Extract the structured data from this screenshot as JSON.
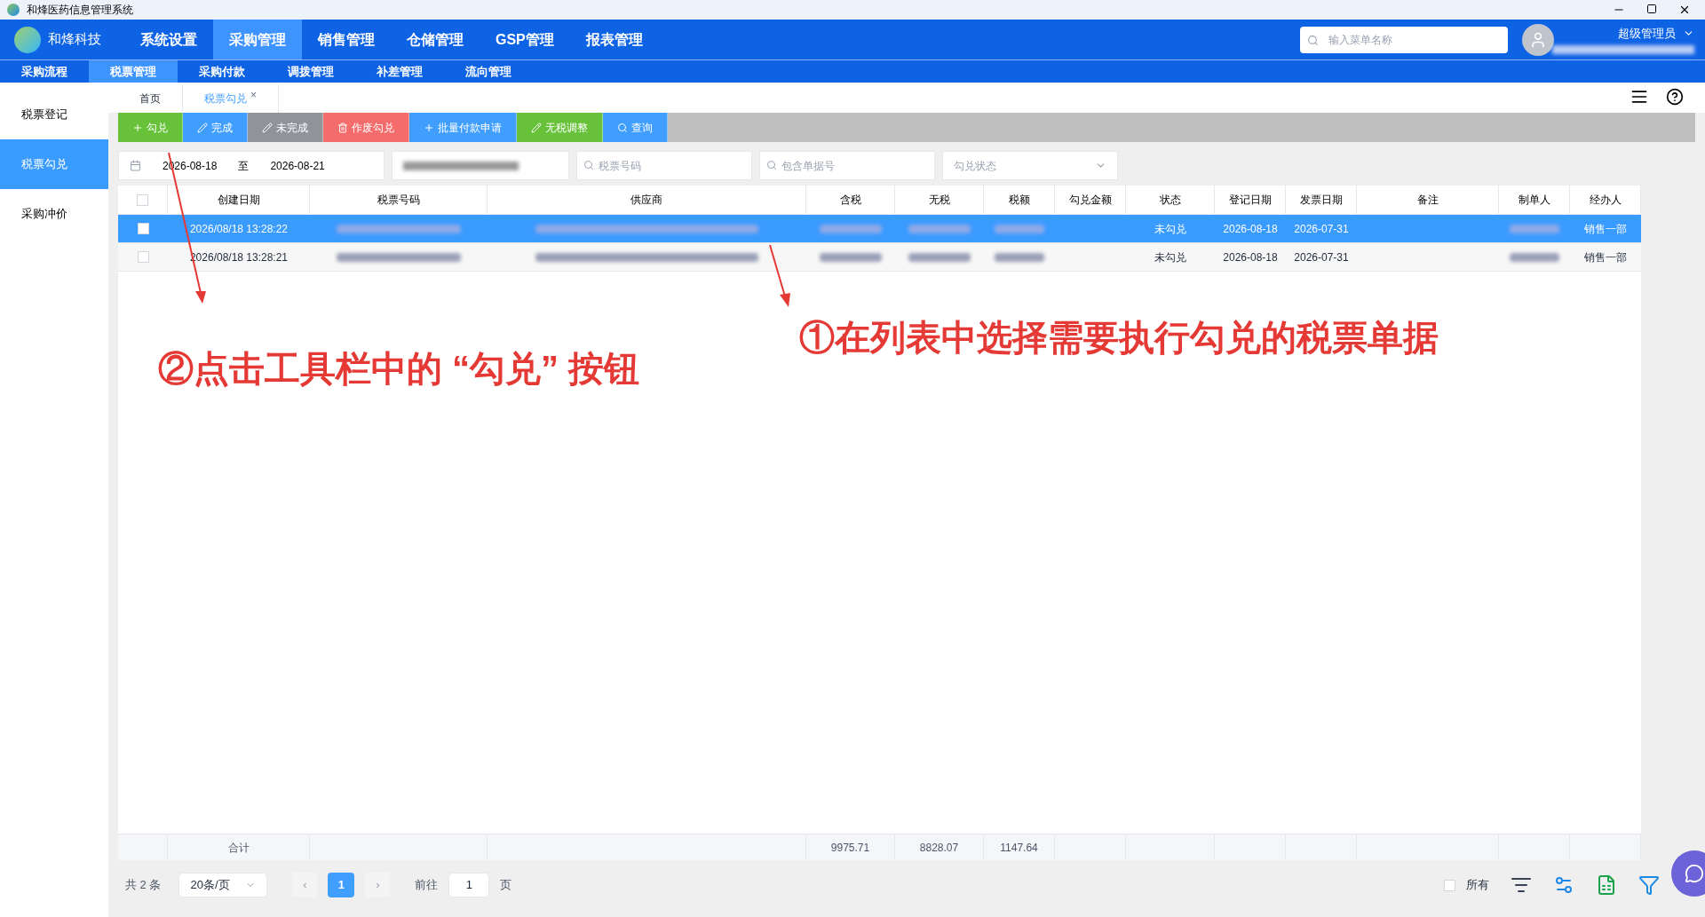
{
  "window": {
    "title": "和烽医药信息管理系统"
  },
  "brand": "和烽科技",
  "main_nav": [
    {
      "label": "系统设置",
      "selected": false
    },
    {
      "label": "采购管理",
      "selected": true
    },
    {
      "label": "销售管理",
      "selected": false
    },
    {
      "label": "仓储管理",
      "selected": false
    },
    {
      "label": "GSP管理",
      "selected": false
    },
    {
      "label": "报表管理",
      "selected": false
    }
  ],
  "menu_search": {
    "placeholder": "输入菜单名称"
  },
  "user": {
    "name": "超级管理员"
  },
  "sub_nav": [
    {
      "label": "采购流程",
      "selected": false
    },
    {
      "label": "税票管理",
      "selected": true
    },
    {
      "label": "采购付款",
      "selected": false
    },
    {
      "label": "调拨管理",
      "selected": false
    },
    {
      "label": "补差管理",
      "selected": false
    },
    {
      "label": "流向管理",
      "selected": false
    }
  ],
  "sidebar": {
    "items": [
      {
        "label": "税票登记",
        "selected": false
      },
      {
        "label": "税票勾兑",
        "selected": true
      },
      {
        "label": "采购冲价",
        "selected": false
      }
    ]
  },
  "page_tabs": [
    {
      "label": "首页",
      "selected": false,
      "closable": false
    },
    {
      "label": "税票勾兑",
      "selected": true,
      "closable": true
    }
  ],
  "close_glyph": "×",
  "toolbar": [
    {
      "label": "勾兑",
      "kind": "plus",
      "color": "#67c23a"
    },
    {
      "label": "完成",
      "kind": "edit",
      "color": "#409eff"
    },
    {
      "label": "未完成",
      "kind": "edit",
      "color": "#909399"
    },
    {
      "label": "作废勾兑",
      "kind": "trash",
      "color": "#f56c6c"
    },
    {
      "label": "批量付款申请",
      "kind": "plus",
      "color": "#409eff"
    },
    {
      "label": "无税调整",
      "kind": "edit",
      "color": "#67c23a"
    },
    {
      "label": "查询",
      "kind": "search",
      "color": "#409eff"
    }
  ],
  "filters": {
    "date_from": "2026-08-18",
    "date_sep": "至",
    "date_to": "2026-08-21",
    "invoice_no": {
      "placeholder": "税票号码"
    },
    "doc_no": {
      "placeholder": "包含单据号"
    },
    "status": {
      "placeholder": "勾兑状态"
    }
  },
  "table": {
    "columns": [
      "创建日期",
      "税票号码",
      "供应商",
      "含税",
      "无税",
      "税额",
      "勾兑金额",
      "状态",
      "登记日期",
      "发票日期",
      "备注",
      "制单人",
      "经办人"
    ],
    "select_all_checked": false,
    "rows": [
      {
        "selected": true,
        "checked": false,
        "cells": [
          {
            "kind": "text",
            "text": "2026/08/18 13:28:22"
          },
          {
            "kind": "redacted"
          },
          {
            "kind": "redacted"
          },
          {
            "kind": "redacted"
          },
          {
            "kind": "redacted"
          },
          {
            "kind": "redacted"
          },
          {
            "kind": "blank"
          },
          {
            "kind": "text",
            "text": "未勾兑"
          },
          {
            "kind": "text",
            "text": "2026-08-18"
          },
          {
            "kind": "text",
            "text": "2026-07-31"
          },
          {
            "kind": "blank"
          },
          {
            "kind": "redacted"
          },
          {
            "kind": "text",
            "text": "销售一部"
          }
        ]
      },
      {
        "selected": false,
        "checked": false,
        "cells": [
          {
            "kind": "text",
            "text": "2026/08/18 13:28:21"
          },
          {
            "kind": "redacted"
          },
          {
            "kind": "redacted"
          },
          {
            "kind": "redacted"
          },
          {
            "kind": "redacted"
          },
          {
            "kind": "redacted"
          },
          {
            "kind": "blank"
          },
          {
            "kind": "text",
            "text": "未勾兑"
          },
          {
            "kind": "text",
            "text": "2026-08-18"
          },
          {
            "kind": "text",
            "text": "2026-07-31"
          },
          {
            "kind": "blank"
          },
          {
            "kind": "redacted"
          },
          {
            "kind": "text",
            "text": "销售一部"
          }
        ]
      }
    ],
    "totals": {
      "label": "合计",
      "cells": [
        {
          "kind": "blank"
        },
        {
          "kind": "blank"
        },
        {
          "kind": "text",
          "text": "9975.71"
        },
        {
          "kind": "text",
          "text": "8828.07"
        },
        {
          "kind": "text",
          "text": "1147.64"
        },
        {
          "kind": "blank"
        },
        {
          "kind": "blank"
        },
        {
          "kind": "blank"
        },
        {
          "kind": "blank"
        },
        {
          "kind": "blank"
        },
        {
          "kind": "blank"
        },
        {
          "kind": "blank"
        }
      ]
    }
  },
  "pagination": {
    "total": "共 2 条",
    "page_size": "20条/页",
    "current": "1",
    "prev": "‹",
    "next": "›",
    "goto_label": "前往",
    "goto_value": "1",
    "goto_suffix": "页"
  },
  "footer": {
    "all_label": "所有",
    "all_checked": false
  },
  "annotations": [
    {
      "text": "②点击工具栏中的 “勾兑” 按钮"
    },
    {
      "text": "①在列表中选择需要执行勾兑的税票单据"
    }
  ]
}
